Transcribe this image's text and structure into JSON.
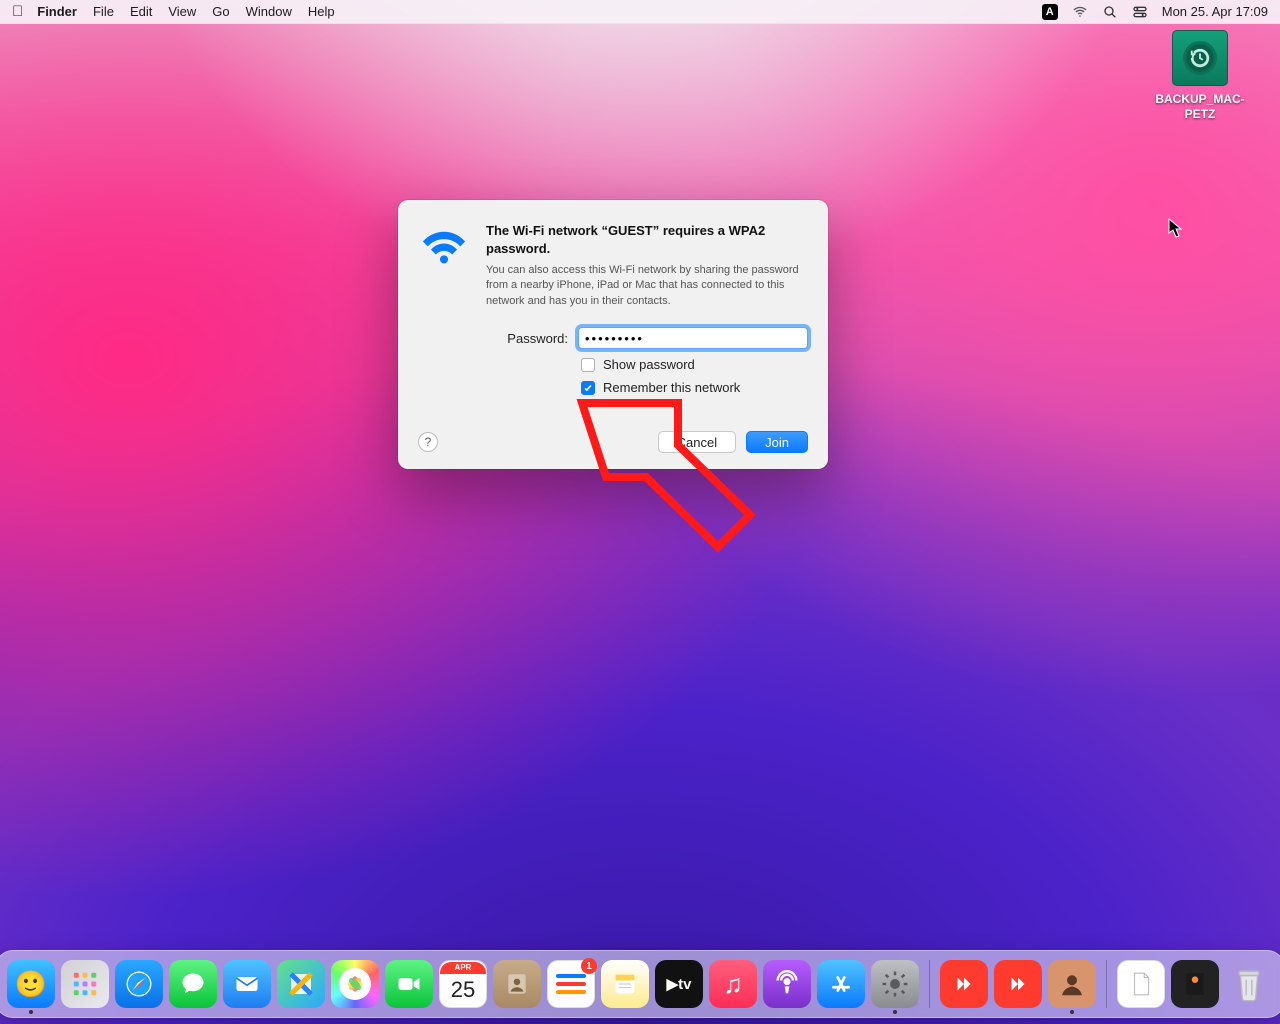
{
  "menubar": {
    "app_name": "Finder",
    "items": [
      "File",
      "Edit",
      "View",
      "Go",
      "Window",
      "Help"
    ],
    "input_indicator": "A",
    "clock": "Mon 25. Apr  17:09"
  },
  "desktop": {
    "drive_label": "BACKUP_MAC-PETZ"
  },
  "dialog": {
    "title": "The Wi-Fi network “GUEST” requires a WPA2 password.",
    "description": "You can also access this Wi-Fi network by sharing the password from a nearby iPhone, iPad or Mac that has connected to this network and has you in their contacts.",
    "password_label": "Password:",
    "password_value": "•••••••••",
    "show_password_label": "Show password",
    "show_password_checked": false,
    "remember_label": "Remember this network",
    "remember_checked": true,
    "help_label": "?",
    "cancel_label": "Cancel",
    "join_label": "Join"
  },
  "dock": {
    "items": [
      {
        "name": "finder",
        "running": true
      },
      {
        "name": "launchpad"
      },
      {
        "name": "safari"
      },
      {
        "name": "messages"
      },
      {
        "name": "mail"
      },
      {
        "name": "maps"
      },
      {
        "name": "photos"
      },
      {
        "name": "facetime"
      },
      {
        "name": "calendar",
        "top": "APR",
        "day": "25"
      },
      {
        "name": "contacts"
      },
      {
        "name": "reminders",
        "badge": "1"
      },
      {
        "name": "notes"
      },
      {
        "name": "tv",
        "glyph": "▶tv"
      },
      {
        "name": "music",
        "glyph": "♪"
      },
      {
        "name": "podcasts"
      },
      {
        "name": "appstore",
        "glyph": "A"
      },
      {
        "name": "system-preferences",
        "running": true
      }
    ],
    "extras": [
      {
        "name": "anydesk-1"
      },
      {
        "name": "anydesk-2"
      },
      {
        "name": "photo-booth",
        "running": true
      }
    ],
    "files": [
      {
        "name": "document"
      },
      {
        "name": "dark-doc"
      }
    ],
    "trash_name": "trash"
  }
}
